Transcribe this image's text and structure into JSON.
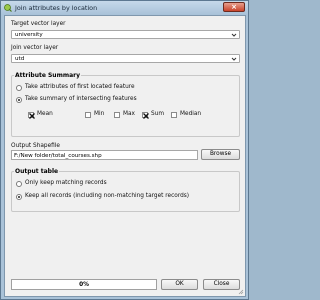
{
  "window": {
    "title": "Join attributes by location",
    "close_glyph": "×"
  },
  "target_layer": {
    "label": "Target vector layer",
    "value": "university"
  },
  "join_layer": {
    "label": "Join vector layer",
    "value": "utd"
  },
  "attribute_summary": {
    "title": "Attribute Summary",
    "options": [
      {
        "label": "Take attributes of first located feature",
        "selected": false
      },
      {
        "label": "Take summary of intersecting features",
        "selected": true
      }
    ],
    "stats": [
      {
        "label": "Mean",
        "checked": true
      },
      {
        "label": "Min",
        "checked": false
      },
      {
        "label": "Max",
        "checked": false
      },
      {
        "label": "Sum",
        "checked": true
      },
      {
        "label": "Median",
        "checked": false
      }
    ]
  },
  "output_shapefile": {
    "label": "Output Shapefile",
    "value": "F:/New folder/total_courses.shp",
    "browse_label": "Browse"
  },
  "output_table": {
    "title": "Output table",
    "options": [
      {
        "label": "Only keep matching records",
        "selected": false
      },
      {
        "label": "Keep all records (including non-matching target records)",
        "selected": true
      }
    ]
  },
  "progress": {
    "text": "0%",
    "value": 0
  },
  "buttons": {
    "ok": "OK",
    "close": "Close"
  },
  "colors": {
    "window_frame": "#a9c2d8",
    "client": "#f0f0f0",
    "close_button": "#c9432b"
  },
  "icons": [
    "qgis-logo-icon",
    "dropdown-arrow-icon",
    "checkmark-icon",
    "resize-grip-icon"
  ]
}
